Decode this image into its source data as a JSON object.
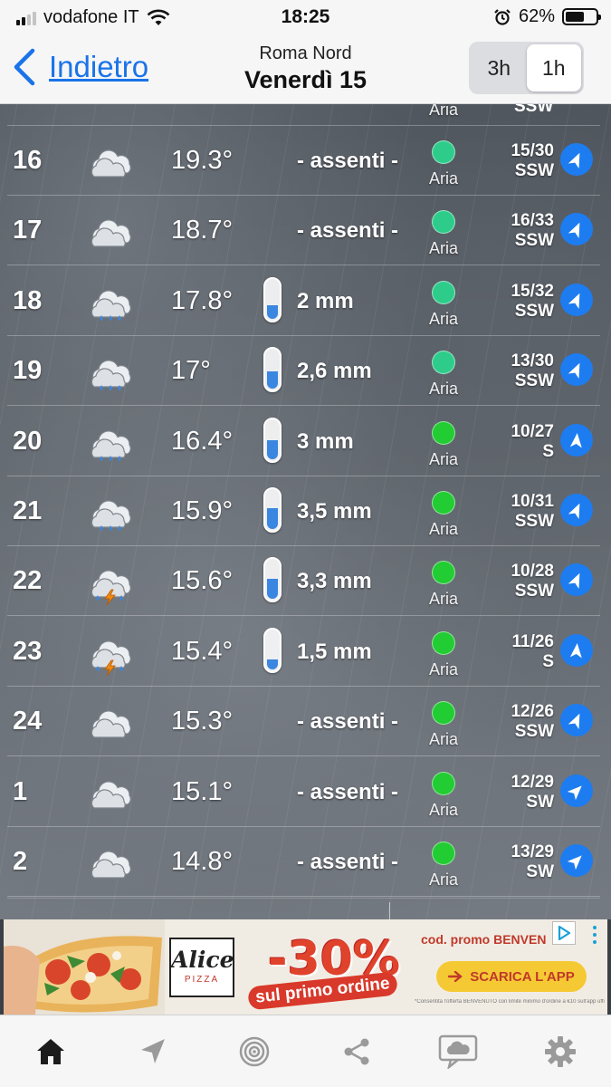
{
  "status": {
    "carrier": "vodafone IT",
    "time": "18:25",
    "battery": "62%",
    "battery_level": 0.62
  },
  "nav": {
    "back_label": "Indietro",
    "location": "Roma Nord",
    "day": "Venerdì 15",
    "segments": [
      "3h",
      "1h"
    ],
    "active_segment": "1h"
  },
  "top_partial": {
    "air_label": "Aria",
    "wind_partial": "SSW"
  },
  "rows": [
    {
      "hour": "16",
      "icon": "cloud-icon",
      "temp": "19.3°",
      "precip": "- assenti -",
      "fill": 0,
      "air": "Aria",
      "air_color": "#2ecc8a",
      "wind_speed": "15/30",
      "wind_dir": "SSW",
      "arrow_deg": 25
    },
    {
      "hour": "17",
      "icon": "cloud-icon",
      "temp": "18.7°",
      "precip": "- assenti -",
      "fill": 0,
      "air": "Aria",
      "air_color": "#2ecc8a",
      "wind_speed": "16/33",
      "wind_dir": "SSW",
      "arrow_deg": 25
    },
    {
      "hour": "18",
      "icon": "rain-cloud-icon",
      "temp": "17.8°",
      "precip": "2 mm",
      "fill": 0.35,
      "air": "Aria",
      "air_color": "#2ecc8a",
      "wind_speed": "15/32",
      "wind_dir": "SSW",
      "arrow_deg": 25
    },
    {
      "hour": "19",
      "icon": "rain-cloud-icon",
      "temp": "17°",
      "precip": "2,6 mm",
      "fill": 0.45,
      "air": "Aria",
      "air_color": "#2ecc8a",
      "wind_speed": "13/30",
      "wind_dir": "SSW",
      "arrow_deg": 25
    },
    {
      "hour": "20",
      "icon": "rain-cloud-icon",
      "temp": "16.4°",
      "precip": "3 mm",
      "fill": 0.5,
      "air": "Aria",
      "air_color": "#22cc33",
      "wind_speed": "10/27",
      "wind_dir": "S",
      "arrow_deg": 5
    },
    {
      "hour": "21",
      "icon": "rain-cloud-icon",
      "temp": "15.9°",
      "precip": "3,5 mm",
      "fill": 0.55,
      "air": "Aria",
      "air_color": "#22cc33",
      "wind_speed": "10/31",
      "wind_dir": "SSW",
      "arrow_deg": 25
    },
    {
      "hour": "22",
      "icon": "storm-cloud-icon",
      "temp": "15.6°",
      "precip": "3,3 mm",
      "fill": 0.52,
      "air": "Aria",
      "air_color": "#22cc33",
      "wind_speed": "10/28",
      "wind_dir": "SSW",
      "arrow_deg": 25
    },
    {
      "hour": "23",
      "icon": "storm-cloud-icon",
      "temp": "15.4°",
      "precip": "1,5 mm",
      "fill": 0.25,
      "air": "Aria",
      "air_color": "#22cc33",
      "wind_speed": "11/26",
      "wind_dir": "S",
      "arrow_deg": 5
    },
    {
      "hour": "24",
      "icon": "cloud-icon",
      "temp": "15.3°",
      "precip": "- assenti -",
      "fill": 0,
      "air": "Aria",
      "air_color": "#22cc33",
      "wind_speed": "12/26",
      "wind_dir": "SSW",
      "arrow_deg": 25
    },
    {
      "hour": "1",
      "icon": "cloud-icon",
      "temp": "15.1°",
      "precip": "- assenti -",
      "fill": 0,
      "air": "Aria",
      "air_color": "#22cc33",
      "wind_speed": "12/29",
      "wind_dir": "SW",
      "arrow_deg": 45
    },
    {
      "hour": "2",
      "icon": "cloud-icon",
      "temp": "14.8°",
      "precip": "- assenti -",
      "fill": 0,
      "air": "Aria",
      "air_color": "#22cc33",
      "wind_speed": "13/29",
      "wind_dir": "SW",
      "arrow_deg": 45
    }
  ],
  "ad": {
    "brand": "Alice",
    "brand_sub": "PIZZA",
    "discount": "-30%",
    "subline": "sul primo ordine",
    "promo": "cod. promo BENVEN",
    "cta": "SCARICA L'APP",
    "fine_print": "*Consentita l'offerta BENVENUTO con limite minimo d'ordine a €10 sull'app ufficiale"
  },
  "tabs": [
    "home-icon",
    "location-arrow-icon",
    "radar-icon",
    "share-icon",
    "chat-cloud-icon",
    "settings-icon"
  ]
}
